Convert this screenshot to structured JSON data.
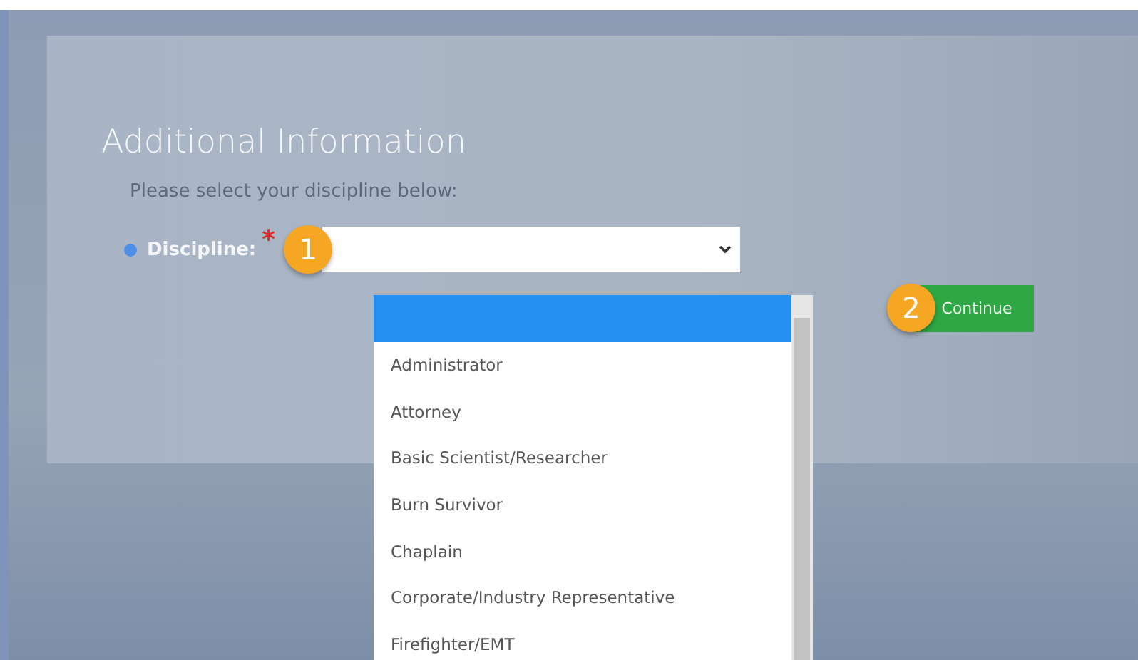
{
  "heading": "Additional Information",
  "prompt": "Please select your discipline below:",
  "field": {
    "label": "Discipline:",
    "required_mark": "*",
    "step_badge": "1",
    "options": [
      {
        "selected": true
      },
      {
        "label": "Administrator",
        "selected": false
      },
      {
        "label": "Attorney",
        "selected": false
      },
      {
        "label": "Basic Scientist/Researcher",
        "selected": false
      },
      {
        "label": "Burn Survivor",
        "selected": false
      },
      {
        "label": "Chaplain",
        "selected": false
      },
      {
        "label": "Corporate/Industry Representative",
        "selected": false
      },
      {
        "label": "Firefighter/EMT",
        "selected": false
      }
    ]
  },
  "continue_button": {
    "label": "Continue",
    "step_badge": "2"
  }
}
